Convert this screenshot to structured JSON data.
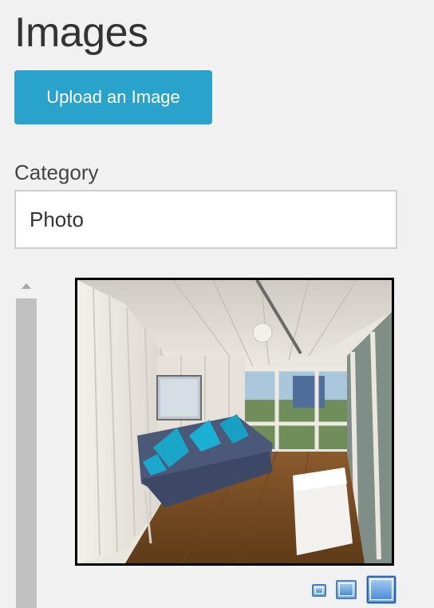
{
  "header": {
    "title": "Images"
  },
  "toolbar": {
    "upload_label": "Upload an Image"
  },
  "category": {
    "label": "Category",
    "value": "Photo"
  },
  "preview": {
    "alt": "Photo"
  },
  "size_toggles": {
    "options": [
      "small",
      "medium",
      "large"
    ],
    "selected": "large"
  },
  "colors": {
    "background": "#f1f1f1",
    "accent": "#2aa3cc",
    "title_text": "#333333",
    "scrollbar_thumb": "#c1c1c1"
  },
  "icons": {
    "scroll_up": "triangle-up-icon",
    "size_small": "small-thumbnail-icon",
    "size_medium": "medium-thumbnail-icon",
    "size_large": "large-thumbnail-icon"
  }
}
